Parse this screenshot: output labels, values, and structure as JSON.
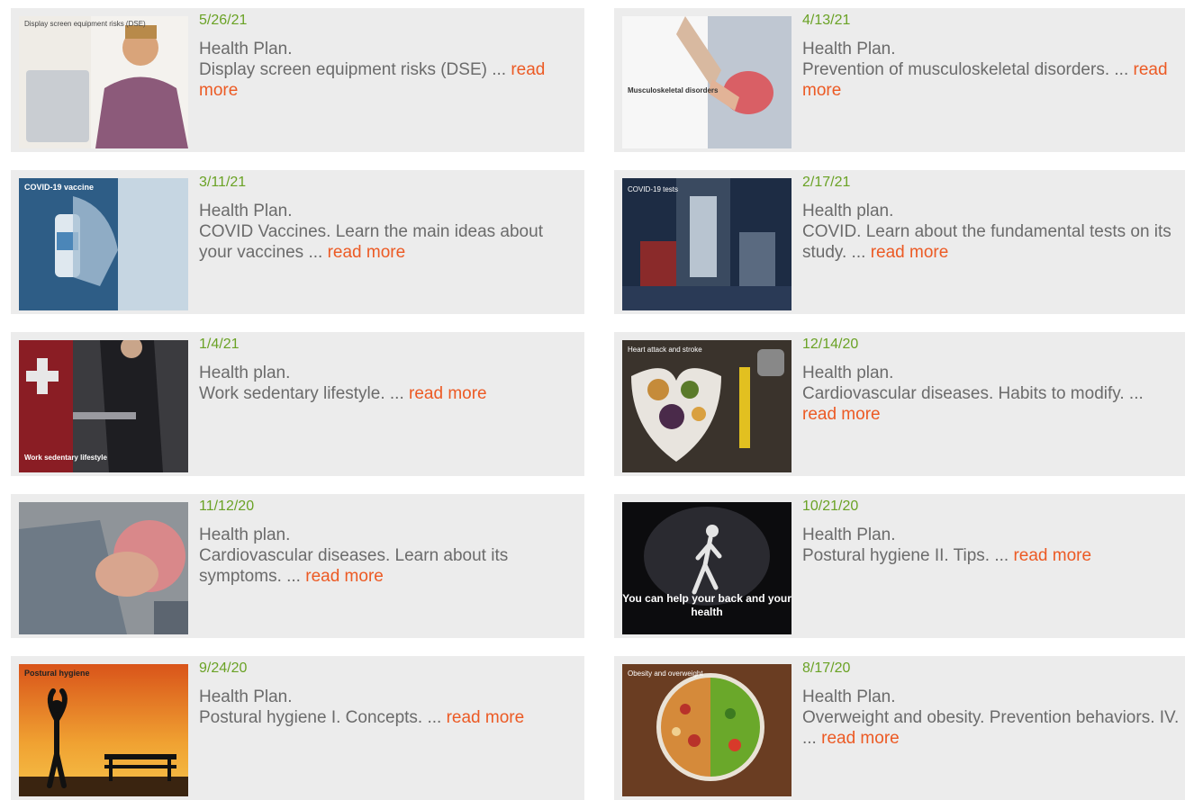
{
  "articles": [
    {
      "date": "5/26/21",
      "category": "Health Plan.",
      "text": "Display screen equipment risks (DSE) ... ",
      "more": "read more",
      "thumb_text": "Display screen equipment risks (DSE)"
    },
    {
      "date": "4/13/21",
      "category": "Health Plan.",
      "text": "Prevention of musculoskeletal disorders. ... ",
      "more": "read more",
      "thumb_text": "Musculoskeletal disorders"
    },
    {
      "date": "3/11/21",
      "category": "Health Plan.",
      "text": "COVID Vaccines. Learn the main ideas about your vaccines ... ",
      "more": "read more",
      "thumb_text": "COVID-19 vaccine"
    },
    {
      "date": "2/17/21",
      "category": "Health plan.",
      "text": "COVID. Learn about the fundamental tests on its study. ... ",
      "more": "read more",
      "thumb_text": "COVID-19 tests"
    },
    {
      "date": "1/4/21",
      "category": "Health plan.",
      "text": "Work sedentary lifestyle. ... ",
      "more": "read more",
      "thumb_text": "Work sedentary lifestyle"
    },
    {
      "date": "12/14/20",
      "category": "Health plan.",
      "text": "Cardiovascular diseases. Habits to modify. ... ",
      "more": "read more",
      "thumb_text": "Heart attack and stroke"
    },
    {
      "date": "11/12/20",
      "category": "Health plan.",
      "text": "Cardiovascular diseases. Learn about its symptoms. ... ",
      "more": "read more",
      "thumb_text": ""
    },
    {
      "date": "10/21/20",
      "category": "Health Plan.",
      "text": "Postural hygiene II. Tips. ... ",
      "more": "read more",
      "thumb_text": "You can help your back and your health"
    },
    {
      "date": "9/24/20",
      "category": "Health Plan.",
      "text": "Postural hygiene I. Concepts. ... ",
      "more": "read more",
      "thumb_text": "Postural hygiene"
    },
    {
      "date": "8/17/20",
      "category": "Health Plan.",
      "text": "Overweight and obesity. Prevention behaviors. IV. ... ",
      "more": "read more",
      "thumb_text": "Obesity and overweight"
    }
  ]
}
